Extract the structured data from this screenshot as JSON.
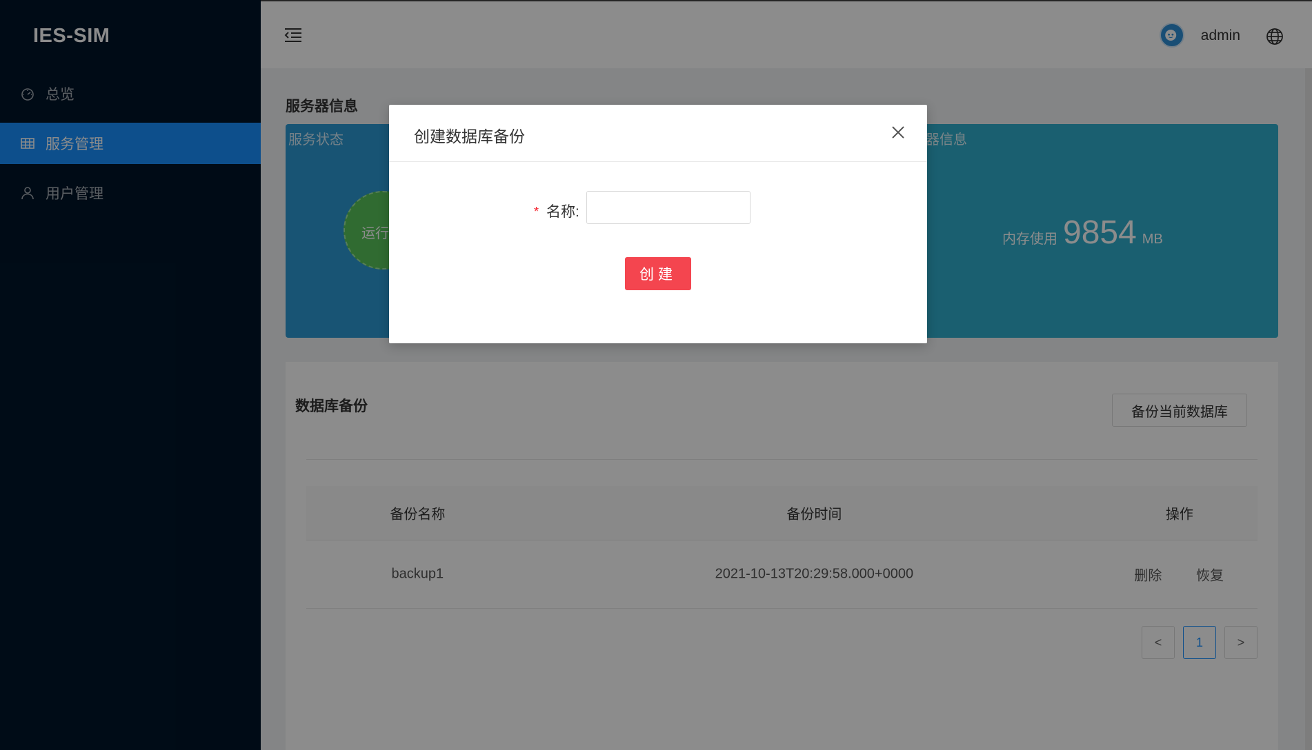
{
  "app": {
    "logo": "IES-SIM"
  },
  "sidebar": {
    "items": [
      {
        "label": "总览",
        "icon": "dashboard-icon",
        "active": false
      },
      {
        "label": "服务管理",
        "icon": "table-icon",
        "active": true
      },
      {
        "label": "用户管理",
        "icon": "user-icon",
        "active": false
      }
    ]
  },
  "header": {
    "username": "admin"
  },
  "server_info": {
    "section_title": "服务器信息",
    "status_card_label": "服务状态",
    "status_text": "运行",
    "info_card_label": "器信息",
    "memory_label": "内存使用",
    "memory_value": "9854",
    "memory_unit": "MB"
  },
  "backup": {
    "title": "数据库备份",
    "backup_button": "备份当前数据库",
    "columns": [
      "备份名称",
      "备份时间",
      "操作"
    ],
    "rows": [
      {
        "name": "backup1",
        "time": "2021-10-13T20:29:58.000+0000",
        "actions": [
          "删除",
          "恢复"
        ]
      }
    ],
    "pagination": {
      "prev": "<",
      "current": "1",
      "next": ">"
    }
  },
  "modal": {
    "title": "创建数据库备份",
    "required_mark": "*",
    "field_label": "名称:",
    "field_value": "",
    "field_placeholder": "",
    "create_button": "创建"
  },
  "colors": {
    "sidebar_bg": "#001529",
    "primary": "#1890ff",
    "status_card": "#2d9ad4",
    "info_card": "#31aecd",
    "create_button": "#f4454f"
  }
}
